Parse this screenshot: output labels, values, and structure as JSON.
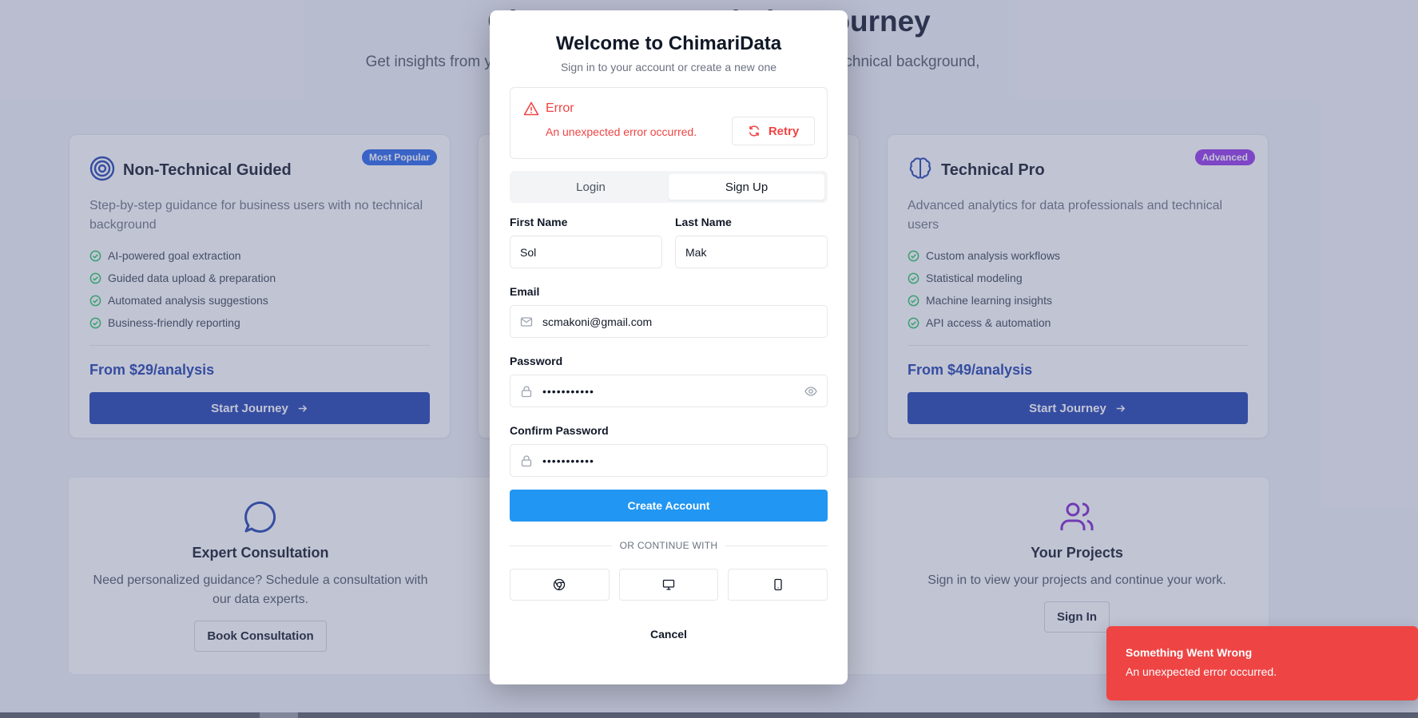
{
  "hero": {
    "title": "Choose Your Analytics Journey",
    "subtitle": "Get insights from your data with AI-powered analysis. No matter your technical background, we'll guide you through your data."
  },
  "cards": [
    {
      "icon": "target-icon",
      "badge": "Most Popular",
      "badge_color": "#2563eb",
      "title": "Non-Technical Guided",
      "description": "Step-by-step guidance for business users with no technical background",
      "features": [
        "AI-powered goal extraction",
        "Guided data upload & preparation",
        "Automated analysis suggestions",
        "Business-friendly reporting"
      ],
      "price": "From $29/analysis",
      "button": "Start Journey"
    },
    {
      "icon": "brain-icon",
      "badge": "Advanced",
      "badge_color": "#9333ea",
      "title": "Technical Pro",
      "description": "Advanced analytics for data professionals and technical users",
      "features": [
        "Custom analysis workflows",
        "Statistical modeling",
        "Machine learning insights",
        "API access & automation"
      ],
      "price": "From $49/analysis",
      "button": "Start Journey"
    }
  ],
  "bottom": {
    "consultation": {
      "title": "Expert Consultation",
      "description": "Need personalized guidance? Schedule a consultation with our data experts.",
      "button": "Book Consultation"
    },
    "projects": {
      "title": "Your Projects",
      "description": "Sign in to view your projects and continue your work.",
      "button": "Sign In"
    }
  },
  "modal": {
    "title": "Welcome to ChimariData",
    "subtitle": "Sign in to your account or create a new one",
    "error": {
      "title": "Error",
      "message": "An unexpected error occurred.",
      "retry": "Retry"
    },
    "tabs": {
      "login": "Login",
      "signup": "Sign Up",
      "active": "Sign Up"
    },
    "form": {
      "first_name_label": "First Name",
      "first_name_value": "Sol",
      "last_name_label": "Last Name",
      "last_name_value": "Mak",
      "email_label": "Email",
      "email_value": "scmakoni@gmail.com",
      "password_label": "Password",
      "password_value": "•••••••••••",
      "confirm_label": "Confirm Password",
      "confirm_value": "•••••••••••"
    },
    "create_button": "Create Account",
    "divider": "OR CONTINUE WITH",
    "social": [
      "chrome-icon",
      "monitor-icon",
      "smartphone-icon"
    ],
    "cancel": "Cancel"
  },
  "toast": {
    "title": "Something Went Wrong",
    "message": "An unexpected error occurred."
  },
  "colors": {
    "primary_dark": "#1e40af",
    "primary": "#2196f3",
    "error": "#ef4444",
    "success": "#22c55e",
    "purple": "#9333ea"
  }
}
